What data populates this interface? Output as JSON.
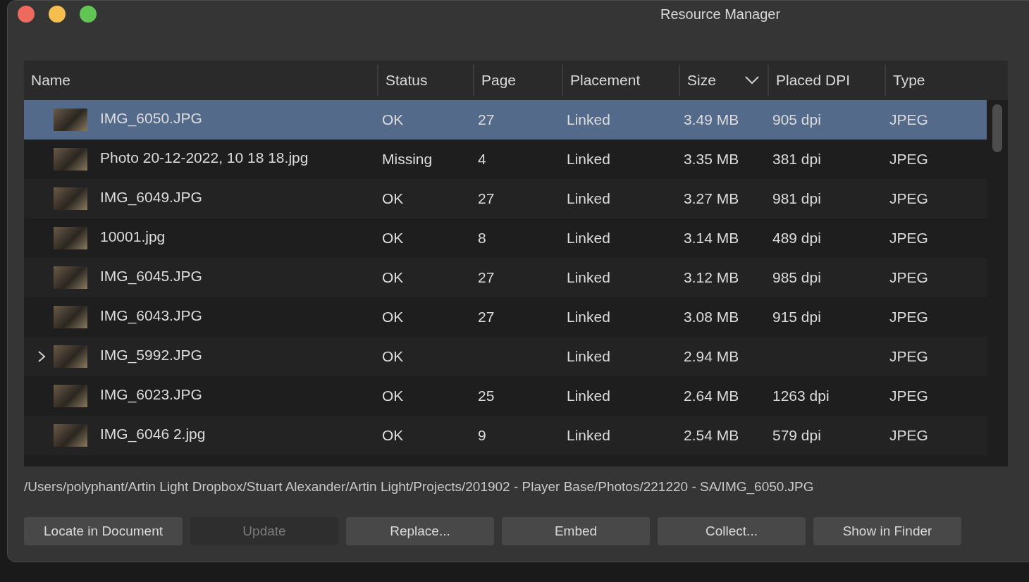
{
  "window": {
    "title": "Resource Manager"
  },
  "table": {
    "columns": [
      {
        "label": "Name",
        "sorted": false
      },
      {
        "label": "Status",
        "sorted": false
      },
      {
        "label": "Page",
        "sorted": false
      },
      {
        "label": "Placement",
        "sorted": false
      },
      {
        "label": "Size",
        "sorted": true
      },
      {
        "label": "Placed DPI",
        "sorted": false
      },
      {
        "label": "Type",
        "sorted": false
      }
    ],
    "rows": [
      {
        "name": "IMG_6050.JPG",
        "status": "OK",
        "page": "27",
        "placement": "Linked",
        "size": "3.49 MB",
        "dpi": "905 dpi",
        "type": "JPEG",
        "selected": true,
        "expandable": false
      },
      {
        "name": "Photo 20-12-2022, 10 18 18.jpg",
        "status": "Missing",
        "page": "4",
        "placement": "Linked",
        "size": "3.35 MB",
        "dpi": "381 dpi",
        "type": "JPEG",
        "selected": false,
        "expandable": false
      },
      {
        "name": "IMG_6049.JPG",
        "status": "OK",
        "page": "27",
        "placement": "Linked",
        "size": "3.27 MB",
        "dpi": "981 dpi",
        "type": "JPEG",
        "selected": false,
        "expandable": false
      },
      {
        "name": "10001.jpg",
        "status": "OK",
        "page": "8",
        "placement": "Linked",
        "size": "3.14 MB",
        "dpi": "489 dpi",
        "type": "JPEG",
        "selected": false,
        "expandable": false
      },
      {
        "name": "IMG_6045.JPG",
        "status": "OK",
        "page": "27",
        "placement": "Linked",
        "size": "3.12 MB",
        "dpi": "985 dpi",
        "type": "JPEG",
        "selected": false,
        "expandable": false
      },
      {
        "name": "IMG_6043.JPG",
        "status": "OK",
        "page": "27",
        "placement": "Linked",
        "size": "3.08 MB",
        "dpi": "915 dpi",
        "type": "JPEG",
        "selected": false,
        "expandable": false
      },
      {
        "name": "IMG_5992.JPG",
        "status": "OK",
        "placement": "Linked",
        "size": "2.94 MB",
        "type": "JPEG",
        "selected": false,
        "expandable": true
      },
      {
        "name": "IMG_6023.JPG",
        "status": "OK",
        "page": "25",
        "placement": "Linked",
        "size": "2.64 MB",
        "dpi": "1263 dpi",
        "type": "JPEG",
        "selected": false,
        "expandable": false
      },
      {
        "name": "IMG_6046 2.jpg",
        "status": "OK",
        "page": "9",
        "placement": "Linked",
        "size": "2.54 MB",
        "dpi": "579 dpi",
        "type": "JPEG",
        "selected": false,
        "expandable": false
      }
    ]
  },
  "path": "/Users/polyphant/Artin Light Dropbox/Stuart Alexander/Artin Light/Projects/201902 - Player Base/Photos/221220 - SA/IMG_6050.JPG",
  "buttons": [
    {
      "label": "Locate in Document",
      "disabled": false
    },
    {
      "label": "Update",
      "disabled": true
    },
    {
      "label": "Replace...",
      "disabled": false
    },
    {
      "label": "Embed",
      "disabled": false
    },
    {
      "label": "Collect...",
      "disabled": false
    },
    {
      "label": "Show in Finder",
      "disabled": false
    }
  ]
}
